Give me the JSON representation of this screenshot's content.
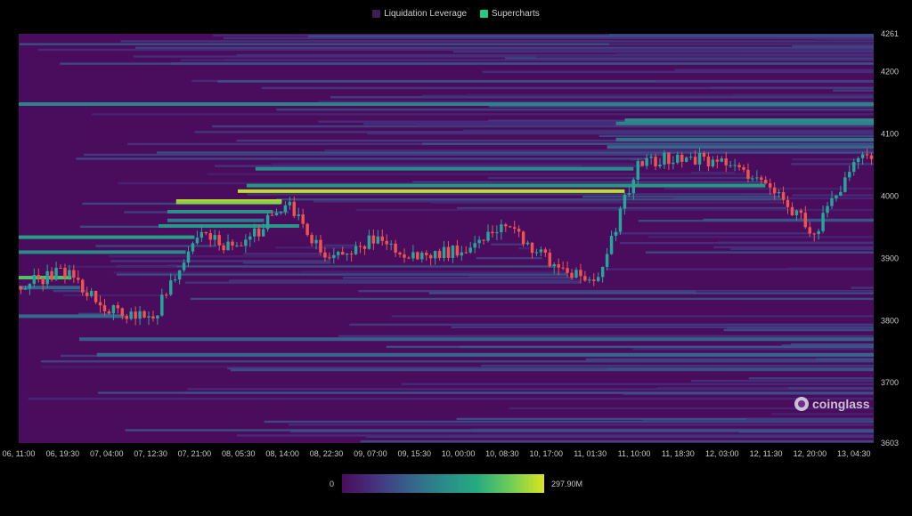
{
  "legend": {
    "items": [
      {
        "label": "Liquidation Leverage",
        "color": "#3d1d55"
      },
      {
        "label": "Supercharts",
        "color": "#24c98a"
      }
    ]
  },
  "watermark": "coinglass",
  "colorbar": {
    "min_label": "0",
    "max_label": "297.90M",
    "stops": [
      "#4a0c5c",
      "#45337e",
      "#36628c",
      "#2a8a8a",
      "#25ab80",
      "#6fcd57",
      "#d9e41f"
    ]
  },
  "colors": {
    "background": "#000000",
    "heatmap_base": "#4a0c5c",
    "candle_up": "#26a69a",
    "candle_down": "#ef5350"
  },
  "chart_data": {
    "type": "heatmap",
    "title": "",
    "xlabel": "",
    "ylabel": "",
    "ylim": [
      3603,
      4261
    ],
    "y_ticks": [
      "4261",
      "4200",
      "4100",
      "4000",
      "3900",
      "3800",
      "3700",
      "3603"
    ],
    "y_tick_values": [
      4261,
      4200,
      4100,
      4000,
      3900,
      3800,
      3700,
      3603
    ],
    "x_ticks": [
      "06, 11:00",
      "06, 19:30",
      "07, 04:00",
      "07, 12:30",
      "07, 21:00",
      "08, 05:30",
      "08, 14:00",
      "08, 22:30",
      "09, 07:00",
      "09, 15:30",
      "10, 00:00",
      "10, 08:30",
      "10, 17:00",
      "11, 01:30",
      "11, 10:00",
      "11, 18:30",
      "12, 03:00",
      "12, 11:30",
      "12, 20:00",
      "13, 04:30"
    ],
    "value_range": [
      0,
      297.9
    ],
    "value_unit": "M",
    "price_path": [
      {
        "x": "06, 11:00",
        "close": 3855
      },
      {
        "x": "06, 19:30",
        "close": 3880
      },
      {
        "x": "07, 04:00",
        "close": 3815
      },
      {
        "x": "07, 12:30",
        "close": 3805
      },
      {
        "x": "07, 21:00",
        "close": 3935
      },
      {
        "x": "08, 05:30",
        "close": 3915
      },
      {
        "x": "08, 14:00",
        "close": 3990
      },
      {
        "x": "08, 22:30",
        "close": 3895
      },
      {
        "x": "09, 07:00",
        "close": 3930
      },
      {
        "x": "09, 15:30",
        "close": 3900
      },
      {
        "x": "10, 00:00",
        "close": 3915
      },
      {
        "x": "10, 08:30",
        "close": 3955
      },
      {
        "x": "10, 17:00",
        "close": 3895
      },
      {
        "x": "11, 01:30",
        "close": 3855
      },
      {
        "x": "11, 10:00",
        "close": 4050
      },
      {
        "x": "11, 18:30",
        "close": 4065
      },
      {
        "x": "12, 03:00",
        "close": 4050
      },
      {
        "x": "12, 11:30",
        "close": 4020
      },
      {
        "x": "12, 20:00",
        "close": 3940
      },
      {
        "x": "13, 04:30",
        "close": 4060
      }
    ],
    "liquidation_bands": [
      {
        "price": 4148,
        "value": 140
      },
      {
        "price": 4122,
        "value": 155
      },
      {
        "price": 4117,
        "value": 140
      },
      {
        "price": 4091,
        "value": 120
      },
      {
        "price": 4079,
        "value": 105
      },
      {
        "price": 4044,
        "value": 150
      },
      {
        "price": 4017,
        "value": 170
      },
      {
        "price": 4008,
        "value": 285
      },
      {
        "price": 3992,
        "value": 290
      },
      {
        "price": 3990,
        "value": 260
      },
      {
        "price": 3975,
        "value": 160
      },
      {
        "price": 3961,
        "value": 130
      },
      {
        "price": 3952,
        "value": 170
      },
      {
        "price": 3934,
        "value": 180
      },
      {
        "price": 3910,
        "value": 150
      },
      {
        "price": 3869,
        "value": 230
      },
      {
        "price": 3853,
        "value": 100
      },
      {
        "price": 3807,
        "value": 110
      },
      {
        "price": 3770,
        "value": 95
      },
      {
        "price": 3745,
        "value": 105
      }
    ]
  }
}
